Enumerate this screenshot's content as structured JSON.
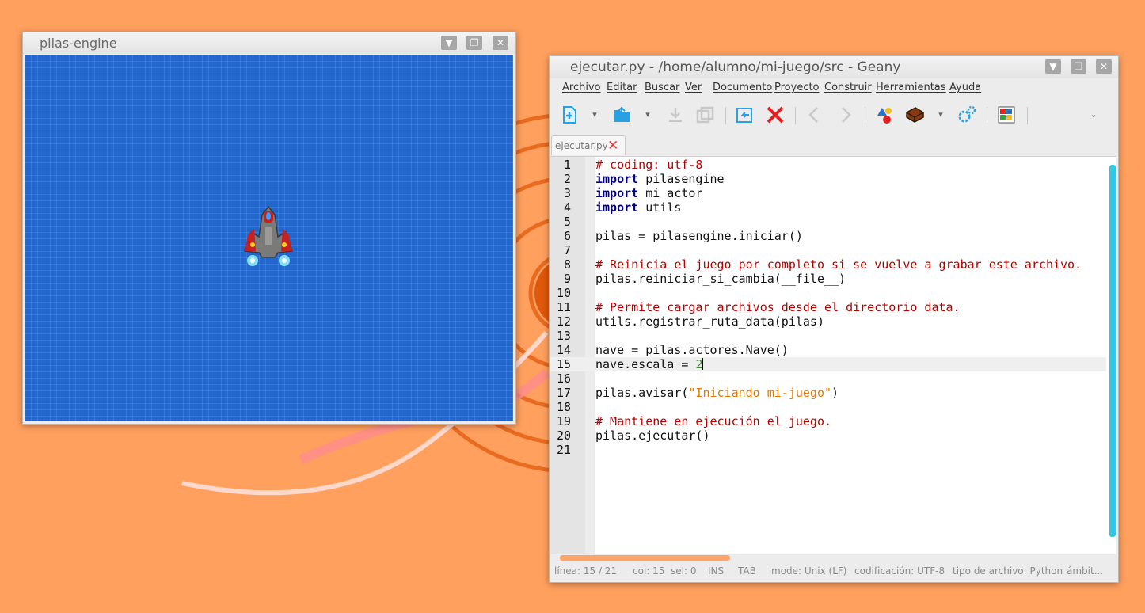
{
  "pilas_window": {
    "title": "pilas-engine"
  },
  "geany_window": {
    "title": "ejecutar.py - /home/alumno/mi-juego/src - Geany",
    "menu": [
      "Archivo",
      "Editar",
      "Buscar",
      "Ver",
      "Documento",
      "Proyecto",
      "Construir",
      "Herramientas",
      "Ayuda"
    ],
    "toolbar_icons": [
      "new-file-icon",
      "open-file-icon",
      "save-icon",
      "save-all-icon",
      "revert-icon",
      "close-icon",
      "back-icon",
      "forward-icon",
      "compile-icon",
      "build-icon",
      "execute-icon",
      "color-chooser-icon",
      "overflow-chevron-icon"
    ],
    "tab": {
      "label": "ejecutar.py",
      "close": "✕"
    },
    "code_lines": [
      {
        "n": "1",
        "tokens": [
          {
            "c": "cm",
            "t": "# coding: utf-8"
          }
        ]
      },
      {
        "n": "2",
        "tokens": [
          {
            "c": "kw",
            "t": "import"
          },
          {
            "c": "tx",
            "t": " pilasengine"
          }
        ]
      },
      {
        "n": "3",
        "tokens": [
          {
            "c": "kw",
            "t": "import"
          },
          {
            "c": "tx",
            "t": " mi_actor"
          }
        ]
      },
      {
        "n": "4",
        "tokens": [
          {
            "c": "kw",
            "t": "import"
          },
          {
            "c": "tx",
            "t": " utils"
          }
        ]
      },
      {
        "n": "5",
        "tokens": []
      },
      {
        "n": "6",
        "tokens": [
          {
            "c": "tx",
            "t": "pilas = pilasengine.iniciar()"
          }
        ]
      },
      {
        "n": "7",
        "tokens": []
      },
      {
        "n": "8",
        "tokens": [
          {
            "c": "cm",
            "t": "# Reinicia el juego por completo si se vuelve a grabar este archivo."
          }
        ]
      },
      {
        "n": "9",
        "tokens": [
          {
            "c": "tx",
            "t": "pilas.reiniciar_si_cambia(__file__)"
          }
        ]
      },
      {
        "n": "10",
        "tokens": []
      },
      {
        "n": "11",
        "tokens": [
          {
            "c": "cm",
            "t": "# Permite cargar archivos desde el directorio data."
          }
        ]
      },
      {
        "n": "12",
        "tokens": [
          {
            "c": "tx",
            "t": "utils.registrar_ruta_data(pilas)"
          }
        ]
      },
      {
        "n": "13",
        "tokens": []
      },
      {
        "n": "14",
        "tokens": [
          {
            "c": "tx",
            "t": "nave = pilas.actores.Nave()"
          }
        ]
      },
      {
        "n": "15",
        "tokens": [
          {
            "c": "tx",
            "t": "nave.escala = "
          },
          {
            "c": "nm",
            "t": "2"
          }
        ],
        "current": true
      },
      {
        "n": "16",
        "tokens": []
      },
      {
        "n": "17",
        "tokens": [
          {
            "c": "tx",
            "t": "pilas.avisar("
          },
          {
            "c": "st",
            "t": "\"Iniciando mi-juego\""
          },
          {
            "c": "tx",
            "t": ")"
          }
        ]
      },
      {
        "n": "18",
        "tokens": []
      },
      {
        "n": "19",
        "tokens": [
          {
            "c": "cm",
            "t": "# Mantiene en ejecución el juego."
          }
        ]
      },
      {
        "n": "20",
        "tokens": [
          {
            "c": "tx",
            "t": "pilas.ejecutar()"
          }
        ]
      },
      {
        "n": "21",
        "tokens": []
      }
    ],
    "status": {
      "line": "línea: 15 / 21",
      "col": "col: 15",
      "sel": "sel: 0",
      "ins": "INS",
      "tab": "TAB",
      "mode": "mode: Unix (LF)",
      "encoding": "codificación: UTF-8",
      "filetype": "tipo de archivo: Python",
      "scope": "ámbit..."
    }
  },
  "colors": {
    "desktop": "#ffa05e",
    "game_bg": "#2366cc",
    "comment": "#b80000",
    "keyword": "#000080",
    "string": "#e07a00",
    "number": "#3a8a3a",
    "scrollbar": "#2ec8e8"
  }
}
